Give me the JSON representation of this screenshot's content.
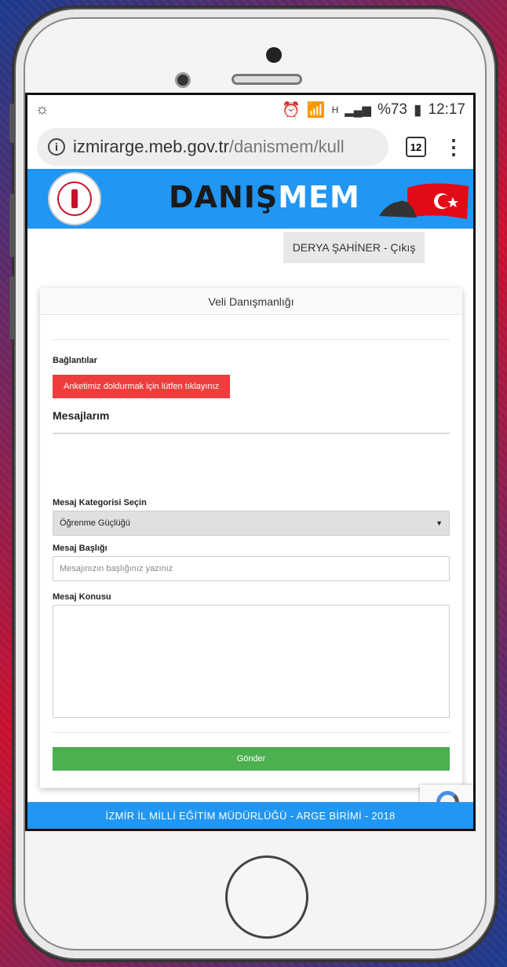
{
  "status_bar": {
    "left_icon": "sun-moon-icon",
    "network": "H",
    "battery": "%73",
    "time": "12:17"
  },
  "browser": {
    "url_domain": "izmirarge.meb.gov.tr",
    "url_path": "/danismem/kull",
    "tab_count": "12"
  },
  "banner": {
    "brand_part1": "DANIŞ",
    "brand_part2": "MEM"
  },
  "user": {
    "logout_label": "DERYA ŞAHİNER - Çıkış"
  },
  "card": {
    "title": "Veli Danışmanlığı",
    "links_label": "Bağlantılar",
    "survey_button": "Anketimiz doldurmak için lütfen tıklayınız",
    "messages_title": "Mesajlarım",
    "category_label": "Mesaj Kategorisi Seçin",
    "category_selected": "Öğrenme Güçlüğü",
    "subject_label": "Mesaj Başlığı",
    "subject_placeholder": "Mesajınızın başlığınız yazınız",
    "content_label": "Mesaj Konusu",
    "send_button": "Gönder"
  },
  "footer": {
    "text": "İZMİR İL MİLLİ EĞİTİM MÜDÜRLÜĞÜ - ARGE BİRİMİ - 2018"
  },
  "colors": {
    "banner_blue": "#2196f3",
    "survey_red": "#ef3d3d",
    "send_green": "#4caf50"
  }
}
